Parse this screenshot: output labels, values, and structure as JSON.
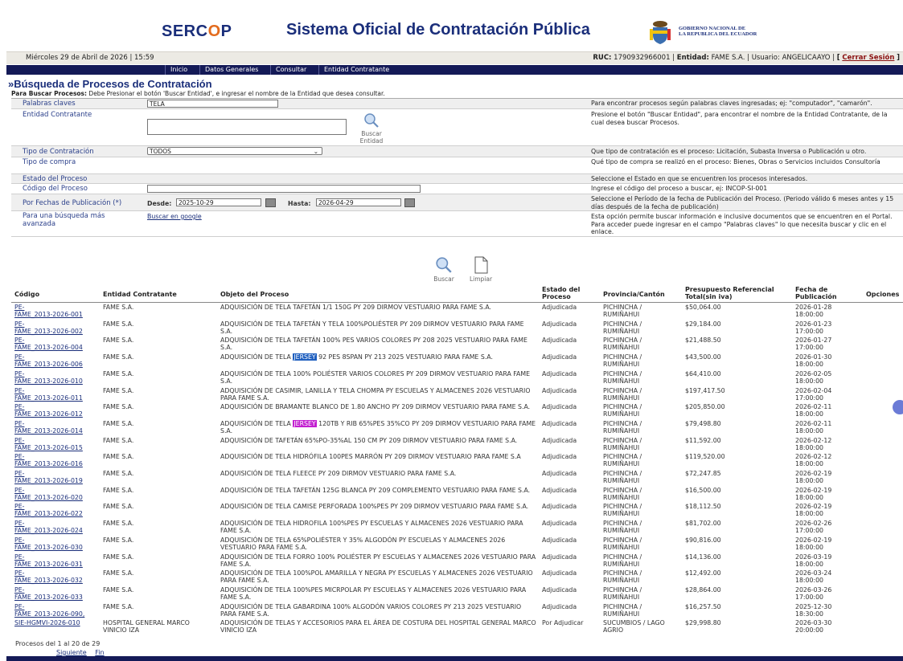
{
  "header": {
    "logo_main": "SERC",
    "logo_accent": "O",
    "logo_end": "P",
    "system_title": "Sistema Oficial de Contratación Pública",
    "gov_line1": "GOBIERNO NACIONAL DE",
    "gov_line2": "LA REPUBLICA DEL ECUADOR"
  },
  "infobar": {
    "date": "Miércoles 29 de Abril de 2026 | 15:59",
    "ruc_label": "RUC:",
    "ruc": "1790932966001",
    "entity_label": "Entidad:",
    "entity": "FAME S.A.",
    "user_label": "Usuario:",
    "user": "ANGELICAAYO",
    "logout": "Cerrar Sesión",
    "bracket_open": "[",
    "bracket_close": "]"
  },
  "nav": {
    "items": [
      "Inicio",
      "Datos Generales",
      "Consultar",
      "Entidad Contratante"
    ]
  },
  "page": {
    "title": "»Búsqueda de Procesos de Contratación",
    "hint_bold": "Para Buscar Procesos:",
    "hint_text": " Debe Presionar el botón 'Buscar Entidad', e ingresar el nombre de la Entidad que desea consultar."
  },
  "form": {
    "keywords_label": "Palabras claves",
    "keywords_value": "TELA",
    "keywords_desc": "Para encontrar procesos según palabras claves ingresadas; ej: \"computador\", \"camarón\".",
    "entity_label": "Entidad Contratante",
    "entity_button_line1": "Buscar",
    "entity_button_line2": "Entidad",
    "entity_desc": "Presione el botón \"Buscar Entidad\", para encontrar el nombre de la Entidad Contratante, de la cual desea buscar Procesos.",
    "type_label": "Tipo de Contratación",
    "type_value": "TODOS",
    "type_desc": "Que tipo de contratación es el proceso: Licitación, Subasta Inversa o Publicación u otro.",
    "purchase_label": "Tipo de compra",
    "purchase_desc": "Qué tipo de compra se realizó en el proceso: Bienes, Obras o Servicios incluidos Consultoría",
    "state_label": "Estado del Proceso",
    "state_desc": "Seleccione el Estado en que se encuentren los procesos interesados.",
    "code_label": "Código del Proceso",
    "code_desc": "Ingrese el código del proceso a buscar, ej: INCOP-SI-001",
    "dates_label": "Por Fechas de Publicación (*)",
    "from_label": "Desde:",
    "from_value": "2025-10-29",
    "to_label": "Hasta:",
    "to_value": "2026-04-29",
    "dates_desc": "Seleccione el Período de la fecha de Publicación del Proceso. (Periodo válido 6 meses antes y 15 días después de la fecha de publicación)",
    "advanced_label": "Para una búsqueda más avanzada",
    "advanced_link": "Buscar en google",
    "advanced_desc": "Esta opción permite buscar información e inclusive documentos que se encuentren en el Portal. Para acceder puede ingresar en el campo \"Palabras claves\" lo que necesita buscar y clic en el enlace."
  },
  "actions": {
    "search": "Buscar",
    "clear": "Limpiar"
  },
  "table": {
    "headers": [
      "Código",
      "Entidad Contratante",
      "Objeto del Proceso",
      "Estado del Proceso",
      "Provincia/Cantón",
      "Presupuesto Referencial Total(sin iva)",
      "Fecha de Publicación",
      "Opciones"
    ],
    "rows": [
      {
        "c1": "PE-",
        "c2": "FAME_2013-2026-001",
        "entity": "FAME S.A.",
        "obj_a": "ADQUISICIÓN DE TELA TAFETÁN 1/1 150G PY 209 DIRMOV VESTUARIO PARA FAME S.A.",
        "hl": "",
        "obj_b": "",
        "state": "Adjudicada",
        "prov1": "PICHINCHA /",
        "prov2": "RUMIÑAHUI",
        "budget": "$50,064.00",
        "d1": "2026-01-28",
        "d2": "18:00:00"
      },
      {
        "c1": "PE-",
        "c2": "FAME_2013-2026-002",
        "entity": "FAME S.A.",
        "obj_a": "ADQUISICIÓN DE TELA TAFETÁN Y TELA 100%POLIÉSTER PY 209 DIRMOV VESTUARIO PARA FAME S.A.",
        "hl": "",
        "obj_b": "",
        "state": "Adjudicada",
        "prov1": "PICHINCHA /",
        "prov2": "RUMIÑAHUI",
        "budget": "$29,184.00",
        "d1": "2026-01-23",
        "d2": "17:00:00"
      },
      {
        "c1": "PE-",
        "c2": "FAME_2013-2026-004",
        "entity": "FAME S.A.",
        "obj_a": "ADQUISICIÓN DE TELA TAFETÁN 100% PES VARIOS COLORES PY 208 2025 VESTUARIO PARA FAME S.A.",
        "hl": "",
        "obj_b": "",
        "state": "Adjudicada",
        "prov1": "PICHINCHA /",
        "prov2": "RUMIÑAHUI",
        "budget": "$21,488.50",
        "d1": "2026-01-27",
        "d2": "17:00:00"
      },
      {
        "c1": "PE-",
        "c2": "FAME_2013-2026-006",
        "entity": "FAME S.A.",
        "obj_a": "ADQUISICIÓN DE TELA ",
        "hl": "JERSEY",
        "hlc": "#1f5fbf",
        "obj_b": " 92 PES 8SPAN PY 213 2025 VESTUARIO PARA FAME S.A.",
        "state": "Adjudicada",
        "prov1": "PICHINCHA /",
        "prov2": "RUMIÑAHUI",
        "budget": "$43,500.00",
        "d1": "2026-01-30",
        "d2": "18:00:00"
      },
      {
        "c1": "PE-",
        "c2": "FAME_2013-2026-010",
        "entity": "FAME S.A.",
        "obj_a": "ADQUISICIÓN DE TELA 100% POLIÉSTER VARIOS COLORES PY 209 DIRMOV VESTUARIO PARA FAME S.A.",
        "hl": "",
        "obj_b": "",
        "state": "Adjudicada",
        "prov1": "PICHINCHA /",
        "prov2": "RUMIÑAHUI",
        "budget": "$64,410.00",
        "d1": "2026-02-05",
        "d2": "18:00:00"
      },
      {
        "c1": "PE-",
        "c2": "FAME_2013-2026-011",
        "entity": "FAME S.A.",
        "obj_a": "ADQUISICIÓN DE CASIMIR, LANILLA Y TELA CHOMPA PY ESCUELAS Y ALMACENES 2026 VESTUARIO PARA FAME S.A.",
        "hl": "",
        "obj_b": "",
        "state": "Adjudicada",
        "prov1": "PICHINCHA /",
        "prov2": "RUMIÑAHUI",
        "budget": "$197,417.50",
        "d1": "2026-02-04",
        "d2": "17:00:00"
      },
      {
        "c1": "PE-",
        "c2": "FAME_2013-2026-012",
        "entity": "FAME S.A.",
        "obj_a": "ADQUISICIÓN DE BRAMANTE BLANCO DE 1.80 ANCHO PY 209 DIRMOV VESTUARIO PARA FAME S.A.",
        "hl": "",
        "obj_b": "",
        "state": "Adjudicada",
        "prov1": "PICHINCHA /",
        "prov2": "RUMIÑAHUI",
        "budget": "$205,850.00",
        "d1": "2026-02-11",
        "d2": "18:00:00"
      },
      {
        "c1": "PE-",
        "c2": "FAME_2013-2026-014",
        "entity": "FAME S.A.",
        "obj_a": "ADQUISICIÓN DE TELA ",
        "hl": "JERSEY",
        "hlc": "#c21fd0",
        "obj_b": " 120TB Y RIB 65%PES 35%CO PY 209 DIRMOV VESTUARIO PARA FAME S.A.",
        "state": "Adjudicada",
        "prov1": "PICHINCHA /",
        "prov2": "RUMIÑAHUI",
        "budget": "$79,498.80",
        "d1": "2026-02-11",
        "d2": "18:00:00"
      },
      {
        "c1": "PE-",
        "c2": "FAME_2013-2026-015",
        "entity": "FAME S.A.",
        "obj_a": "ADQUISICIÓN DE TAFETÁN 65%PO-35%AL 150 CM PY 209 DIRMOV VESTUARIO PARA FAME S.A.",
        "hl": "",
        "obj_b": "",
        "state": "Adjudicada",
        "prov1": "PICHINCHA /",
        "prov2": "RUMIÑAHUI",
        "budget": "$11,592.00",
        "d1": "2026-02-12",
        "d2": "18:00:00"
      },
      {
        "c1": "PE-",
        "c2": "FAME_2013-2026-016",
        "entity": "FAME S.A.",
        "obj_a": "ADQUISICIÓN DE TELA HIDRÓFILA 100PES MARRÓN PY 209 DIRMOV VESTUARIO PARA FAME S.A",
        "hl": "",
        "obj_b": "",
        "state": "Adjudicada",
        "prov1": "PICHINCHA /",
        "prov2": "RUMIÑAHUI",
        "budget": "$119,520.00",
        "d1": "2026-02-12",
        "d2": "18:00:00"
      },
      {
        "c1": "PE-",
        "c2": "FAME_2013-2026-019",
        "entity": "FAME S.A.",
        "obj_a": "ADQUISICIÓN DE TELA FLEECE PY 209 DIRMOV VESTUARIO PARA FAME S.A.",
        "hl": "",
        "obj_b": "",
        "state": "Adjudicada",
        "prov1": "PICHINCHA /",
        "prov2": "RUMIÑAHUI",
        "budget": "$72,247.85",
        "d1": "2026-02-19",
        "d2": "18:00:00"
      },
      {
        "c1": "PE-",
        "c2": "FAME_2013-2026-020",
        "entity": "FAME S.A.",
        "obj_a": "ADQUISICIÓN DE TELA TAFETÁN 125G BLANCA PY 209 COMPLEMENTO VESTUARIO PARA FAME S.A.",
        "hl": "",
        "obj_b": "",
        "state": "Adjudicada",
        "prov1": "PICHINCHA /",
        "prov2": "RUMIÑAHUI",
        "budget": "$16,500.00",
        "d1": "2026-02-19",
        "d2": "18:00:00"
      },
      {
        "c1": "PE-",
        "c2": "FAME_2013-2026-022",
        "entity": "FAME S.A.",
        "obj_a": "ADQUISICIÓN DE TELA CAMISE PERFORADA 100%PES PY 209 DIRMOV VESTUARIO PARA FAME S.A.",
        "hl": "",
        "obj_b": "",
        "state": "Adjudicada",
        "prov1": "PICHINCHA /",
        "prov2": "RUMIÑAHUI",
        "budget": "$18,112.50",
        "d1": "2026-02-19",
        "d2": "18:00:00"
      },
      {
        "c1": "PE-",
        "c2": "FAME_2013-2026-024",
        "entity": "FAME S.A.",
        "obj_a": "ADQUISICIÓN DE TELA HIDROFILA 100%PES PY ESCUELAS Y ALMACENES 2026 VESTUARIO PARA FAME S.A.",
        "hl": "",
        "obj_b": "",
        "state": "Adjudicada",
        "prov1": "PICHINCHA /",
        "prov2": "RUMIÑAHUI",
        "budget": "$81,702.00",
        "d1": "2026-02-26",
        "d2": "17:00:00"
      },
      {
        "c1": "PE-",
        "c2": "FAME_2013-2026-030",
        "entity": "FAME S.A.",
        "obj_a": "ADQUISICIÓN DE TELA 65%POLIÉSTER Y 35% ALGODÓN PY ESCUELAS Y ALMACENES 2026 VESTUARIO PARA FAME S.A.",
        "hl": "",
        "obj_b": "",
        "state": "Adjudicada",
        "prov1": "PICHINCHA /",
        "prov2": "RUMIÑAHUI",
        "budget": "$90,816.00",
        "d1": "2026-02-19",
        "d2": "18:00:00"
      },
      {
        "c1": "PE-",
        "c2": "FAME_2013-2026-031",
        "entity": "FAME S.A.",
        "obj_a": "ADQUISICIÓN DE TELA FORRO 100% POLIÉSTER PY ESCUELAS Y ALMACENES 2026 VESTUARIO PARA FAME S.A.",
        "hl": "",
        "obj_b": "",
        "state": "Adjudicada",
        "prov1": "PICHINCHA /",
        "prov2": "RUMIÑAHUI",
        "budget": "$14,136.00",
        "d1": "2026-03-19",
        "d2": "18:00:00"
      },
      {
        "c1": "PE-",
        "c2": "FAME_2013-2026-032",
        "entity": "FAME S.A.",
        "obj_a": "ADQUISICIÓN DE TELA 100%POL AMARILLA Y NEGRA PY ESCUELAS Y ALMACENES 2026 VESTUARIO PARA FAME S.A.",
        "hl": "",
        "obj_b": "",
        "state": "Adjudicada",
        "prov1": "PICHINCHA /",
        "prov2": "RUMIÑAHUI",
        "budget": "$12,492.00",
        "d1": "2026-03-24",
        "d2": "18:00:00"
      },
      {
        "c1": "PE-",
        "c2": "FAME_2013-2026-033",
        "entity": "FAME S.A.",
        "obj_a": "ADQUISICIÓN DE TELA 100%PES MICRPOLAR PY ESCUELAS Y ALMACENES 2026 VESTUARIO PARA FAME S.A.",
        "hl": "",
        "obj_b": "",
        "state": "Adjudicada",
        "prov1": "PICHINCHA /",
        "prov2": "RUMIÑAHUI",
        "budget": "$28,864.00",
        "d1": "2026-03-26",
        "d2": "17:00:00"
      },
      {
        "c1": "PE-",
        "c2": "FAME_2013-2026-090,",
        "entity": "FAME S.A.",
        "obj_a": "ADQUISICIÓN DE TELA GABARDINA 100% ALGODÓN VARIOS COLORES PY 213 2025 VESTUARIO PARA FAME S.A.",
        "hl": "",
        "obj_b": "",
        "state": "Adjudicada",
        "prov1": "PICHINCHA /",
        "prov2": "RUMIÑAHUI",
        "budget": "$16,257.50",
        "d1": "2025-12-30",
        "d2": "18:30:00"
      },
      {
        "c1": "SIE-HGMVI-2026-010",
        "c2": "",
        "entity": "HOSPITAL GENERAL MARCO VINICIO IZA",
        "obj_a": "ADQUISICIÓN DE TELAS Y ACCESORIOS PARA EL ÁREA DE COSTURA DEL HOSPITAL GENERAL MARCO VINICIO IZA",
        "hl": "",
        "obj_b": "",
        "state": "Por Adjudicar",
        "prov1": "SUCUMBIOS / LAGO",
        "prov2": "AGRIO",
        "budget": "$29,998.80",
        "d1": "2026-03-30",
        "d2": "20:00:00"
      }
    ]
  },
  "footer": {
    "summary": "Procesos del 1 al 20 de 29",
    "next": "Siguiente",
    "end": "Fin"
  },
  "icons": {
    "search": "magnifier-icon",
    "clear": "blank-page-icon",
    "calendar": "calendar-icon"
  }
}
